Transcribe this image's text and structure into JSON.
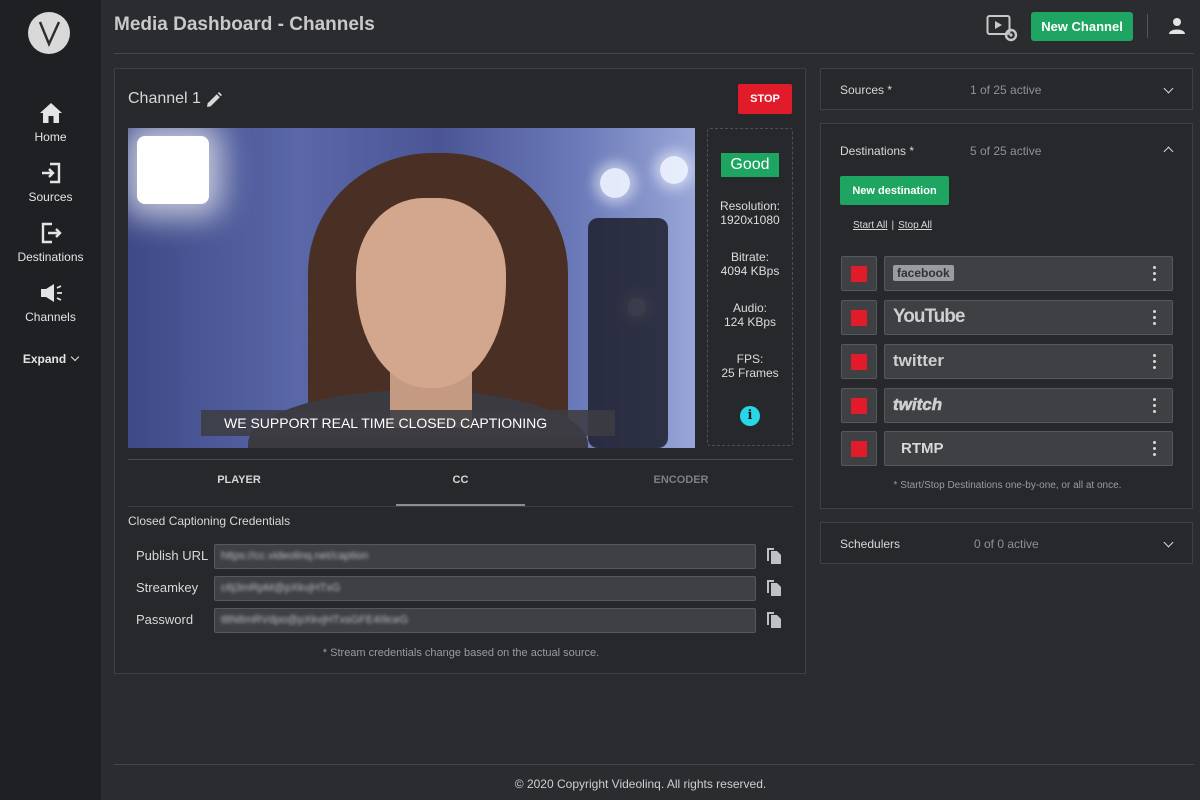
{
  "app": {
    "title": "Media Dashboard - Channels",
    "logo_letter": "V"
  },
  "sidebar": {
    "items": [
      {
        "label": "Home",
        "icon": "home-icon"
      },
      {
        "label": "Sources",
        "icon": "sign-in-icon"
      },
      {
        "label": "Destinations",
        "icon": "sign-out-icon"
      },
      {
        "label": "Channels",
        "icon": "megaphone-icon"
      }
    ],
    "expand_label": "Expand"
  },
  "header": {
    "new_channel_label": "New Channel",
    "media_settings_icon": "media-settings-icon",
    "user_icon": "user-icon"
  },
  "channel": {
    "name": "Channel 1",
    "stop_label": "STOP",
    "caption_text": "WE SUPPORT REAL TIME CLOSED CAPTIONING",
    "stats": {
      "quality": "Good",
      "resolution_label": "Resolution:",
      "resolution_value": "1920x1080",
      "bitrate_label": "Bitrate:",
      "bitrate_value": "4094 KBps",
      "audio_label": "Audio:",
      "audio_value": "124 KBps",
      "fps_label": "FPS:",
      "fps_value": "25 Frames"
    },
    "tabs": [
      {
        "label": "PLAYER",
        "active": false
      },
      {
        "label": "CC",
        "active": true
      },
      {
        "label": "ENCODER",
        "active": false
      }
    ],
    "cc": {
      "heading": "Closed Captioning Credentials",
      "fields": [
        {
          "label": "Publish URL",
          "value": "https://cc.videolinq.net/caption"
        },
        {
          "label": "Streamkey",
          "value": "c6j3mRpM@pXkvjHTxG"
        },
        {
          "label": "Password",
          "value": "t8N8mRVdpo@pXkvjHTxsGFE4i9ceG"
        }
      ],
      "note": "* Stream credentials change based on the actual source."
    }
  },
  "sources_panel": {
    "title": "Sources *",
    "count": "1 of 25 active"
  },
  "destinations_panel": {
    "title": "Destinations *",
    "count": "5 of 25 active",
    "new_label": "New destination",
    "start_all": "Start All",
    "separator": "|",
    "stop_all": "Stop All",
    "items": [
      {
        "name": "facebook"
      },
      {
        "name": "YouTube"
      },
      {
        "name": "twitter"
      },
      {
        "name": "twitch"
      },
      {
        "name": "RTMP"
      }
    ],
    "note": "* Start/Stop Destinations one-by-one, or all at once."
  },
  "schedulers_panel": {
    "title": "Schedulers",
    "count": "0 of 0 active"
  },
  "footer": {
    "copyright": "© 2020 Copyright Videolinq. All rights reserved."
  },
  "colors": {
    "accent_green": "#1fa562",
    "stop_red": "#e21b2b",
    "info_cyan": "#27d7e9",
    "background": "#2a2c2f",
    "sidebar": "#1f2023"
  }
}
